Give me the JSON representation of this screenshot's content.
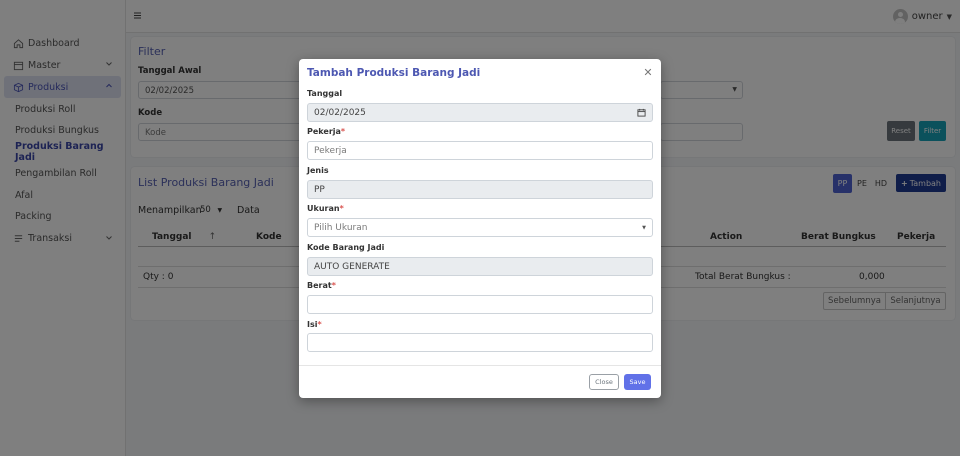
{
  "sidebar": {
    "dashboard": "Dashboard",
    "master": "Master",
    "produksi": "Produksi",
    "sub_items": [
      "Produksi Roll",
      "Produksi Bungkus",
      "Produksi Barang Jadi",
      "Pengambilan Roll",
      "Afal",
      "Packing"
    ],
    "transaksi": "Transaksi"
  },
  "topbar": {
    "user": "owner"
  },
  "filter": {
    "title": "Filter",
    "tanggal_awal_label": "Tanggal Awal",
    "tanggal_awal_value": "02/02/2025",
    "kode_label": "Kode",
    "kode_placeholder": "Kode",
    "reset_label": "Reset",
    "filter_label": "Filter"
  },
  "list": {
    "title": "List Produksi Barang Jadi",
    "segments": [
      "PP",
      "PE",
      "HD"
    ],
    "tambah_label": "Tambah",
    "menampilkan_label": "Menampilkan",
    "page_size": "50",
    "data_label": "Data",
    "columns": {
      "tanggal": "Tanggal",
      "kode": "Kode",
      "action": "Action",
      "berat_bungkus": "Berat Bungkus",
      "pekerja": "Pekerja"
    },
    "sort_icon": "↑",
    "qty": "Qty : 0",
    "total_label": "Total Berat Bungkus :",
    "total_value": "0,000",
    "prev_label": "Sebelumnya",
    "next_label": "Selanjutnya"
  },
  "modal": {
    "title": "Tambah Produksi Barang Jadi",
    "tanggal_label": "Tanggal",
    "tanggal_value": "02/02/2025",
    "pekerja_label": "Pekerja",
    "pekerja_placeholder": "Pekerja",
    "jenis_label": "Jenis",
    "jenis_value": "PP",
    "ukuran_label": "Ukuran",
    "ukuran_placeholder": "Pilih Ukuran",
    "kode_label": "Kode Barang Jadi",
    "kode_value": "AUTO GENERATE",
    "berat_label": "Berat",
    "isi_label": "Isi",
    "required_mark": "*",
    "close_label": "Close",
    "save_label": "Save"
  },
  "colors": {
    "accent": "#5661b3",
    "save": "#6171e8",
    "tambah": "#1f3a93",
    "filter_btn": "#17a2b8",
    "reset_btn": "#6c757d"
  }
}
